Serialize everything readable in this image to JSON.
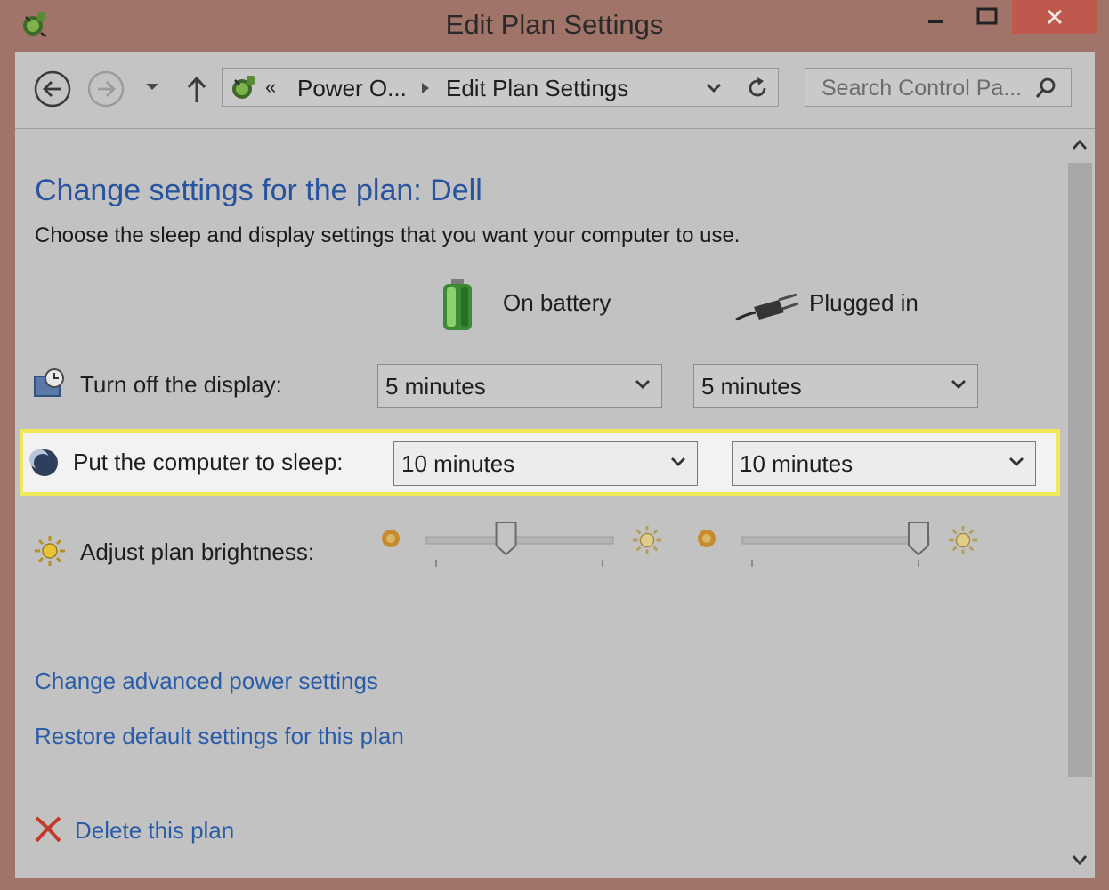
{
  "window": {
    "title": "Edit Plan Settings"
  },
  "navigation": {
    "breadcrumb_chevron": "«",
    "breadcrumb_items": [
      "Power O...",
      "Edit Plan Settings"
    ],
    "search_placeholder": "Search Control Pa..."
  },
  "main": {
    "heading": "Change settings for the plan: Dell",
    "description": "Choose the sleep and display settings that you want your computer to use.",
    "columns": {
      "battery": "On battery",
      "plugged": "Plugged in"
    },
    "settings": {
      "display": {
        "label": "Turn off the display:",
        "battery_value": "5 minutes",
        "plugged_value": "5 minutes"
      },
      "sleep": {
        "label": "Put the computer to sleep:",
        "battery_value": "10 minutes",
        "plugged_value": "10 minutes"
      },
      "brightness": {
        "label": "Adjust plan brightness:",
        "battery_level": 0.42,
        "plugged_level": 1.0
      }
    },
    "links": {
      "advanced": "Change advanced power settings",
      "restore": "Restore default settings for this plan",
      "delete": "Delete this plan"
    }
  },
  "colors": {
    "link": "#2a5ca8",
    "heading": "#28539e",
    "highlight_border": "#f0e95a",
    "close_button": "#bd5a4d"
  },
  "icons": {
    "app": "power-options-icon",
    "back": "back-arrow-icon",
    "forward": "forward-arrow-icon",
    "recent": "chevron-down-icon",
    "up": "up-arrow-icon",
    "refresh": "refresh-icon",
    "search": "search-icon",
    "battery": "battery-icon",
    "plug": "plug-icon",
    "display": "display-clock-icon",
    "sleep": "moon-icon",
    "brightness": "sun-icon",
    "delete": "red-x-icon"
  }
}
